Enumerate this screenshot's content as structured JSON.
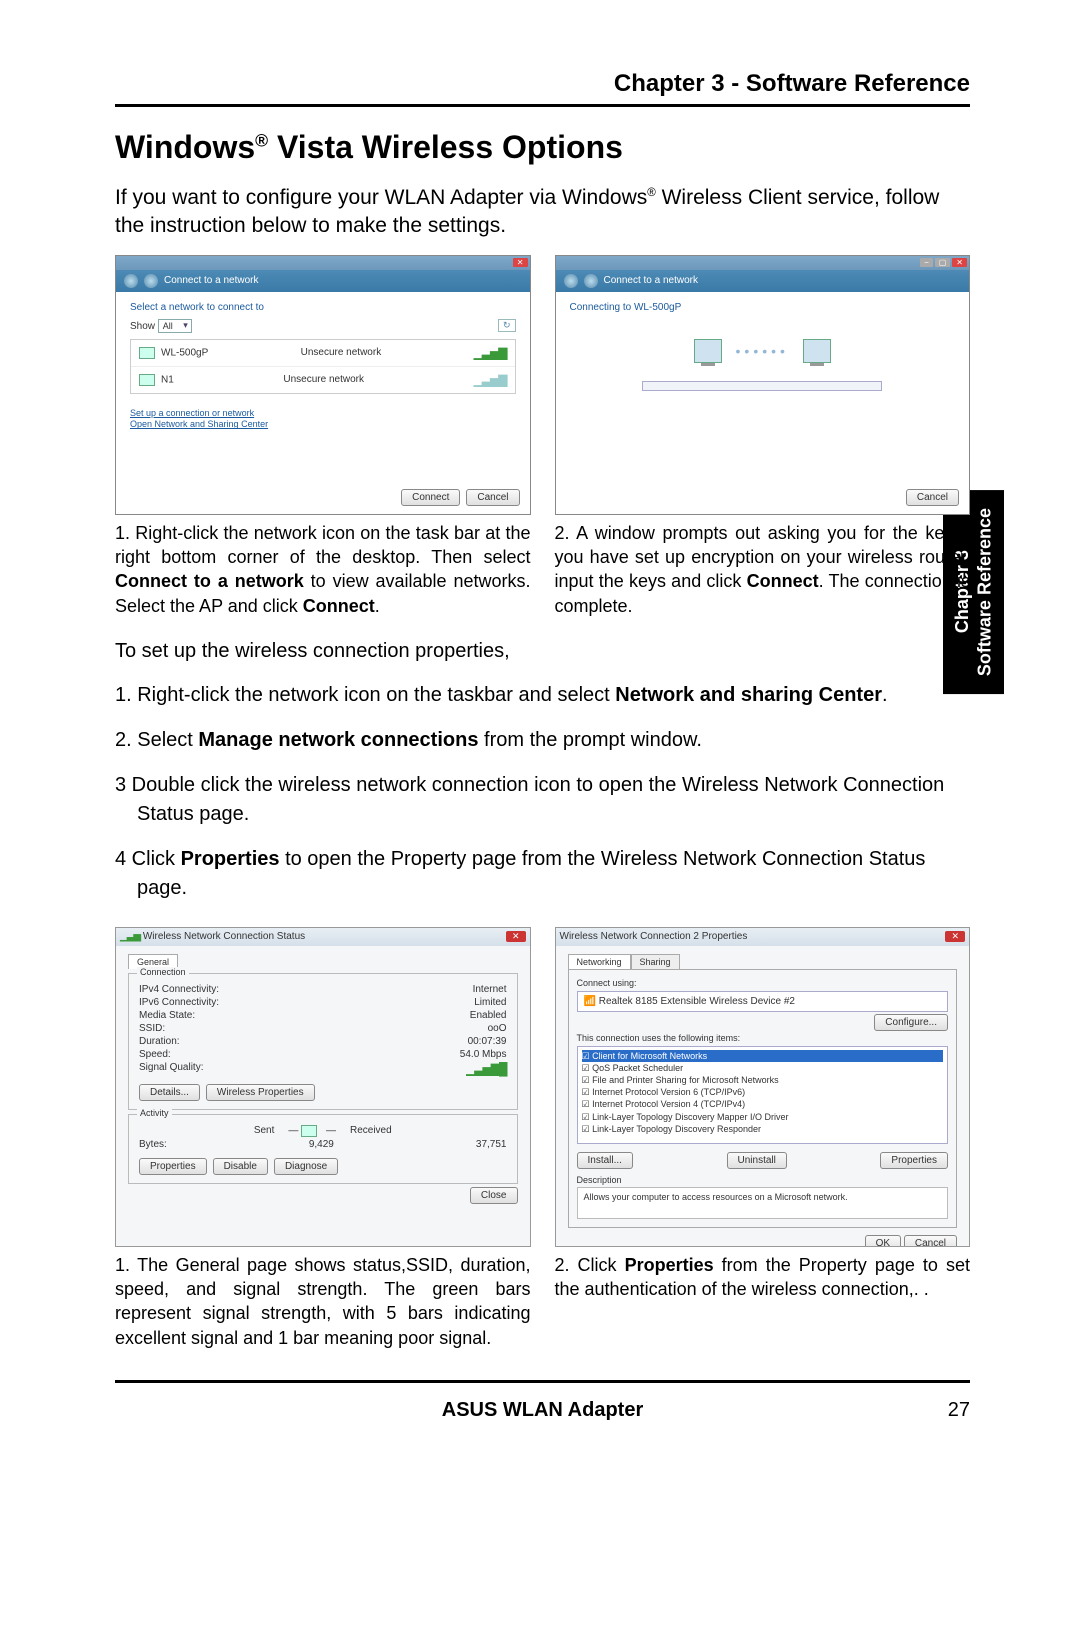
{
  "header": {
    "chapter_title": "Chapter 3 - Software Reference"
  },
  "title": {
    "prefix": "Windows",
    "reg": "®",
    "rest": " Vista Wireless Options"
  },
  "intro": {
    "t1": "If you want to configure your WLAN Adapter via Windows",
    "reg": "®",
    "t2": " Wireless Client service, follow the instruction below to make the settings."
  },
  "win1": {
    "breadcrumb": "Connect to a network",
    "heading": "Select a network to connect to",
    "show_lbl": "Show",
    "show_val": "All",
    "refresh": "↻",
    "net1_name": "WL-500gP",
    "net1_type": "Unsecure network",
    "net2_name": "N1",
    "net2_type": "Unsecure network",
    "link1": "Set up a connection or network",
    "link2": "Open Network and Sharing Center",
    "btn_connect": "Connect",
    "btn_cancel": "Cancel"
  },
  "win2": {
    "breadcrumb": "Connect to a network",
    "status": "Connecting to WL-500gP",
    "btn_cancel": "Cancel"
  },
  "step1": "1. Right-click the network icon on the task bar at the right bottom corner of the desktop. Then select ",
  "step1b": "Connect to a network",
  "step1c": " to view available networks. Select the AP and click ",
  "step1d": "Connect",
  "step1e": ".",
  "step2": "2. A window prompts out asking you for the key if you have set up encryption on your wireless router, input the keys and click ",
  "step2b": "Connect",
  "step2c": ". The connection is complete.",
  "props_intro": "To set up the wireless connection properties,",
  "prop_steps": {
    "s1a": "1. Right-click the network icon on the taskbar and select ",
    "s1b": "Network and sharing Center",
    "s1c": ".",
    "s2a": "2. Select ",
    "s2b": "Manage network connections",
    "s2c": " from the prompt window.",
    "s3": "3  Double click the wireless network connection icon to open the Wireless Network Connection Status page.",
    "s4a": "4 Click ",
    "s4b": "Properties",
    "s4c": " to open the Property page from the Wireless Network Connection Status page."
  },
  "dlgA": {
    "title": "Wireless Network Connection Status",
    "tab": "General",
    "fs1": "Connection",
    "ipv4_l": "IPv4 Connectivity:",
    "ipv4_v": "Internet",
    "ipv6_l": "IPv6 Connectivity:",
    "ipv6_v": "Limited",
    "media_l": "Media State:",
    "media_v": "Enabled",
    "ssid_l": "SSID:",
    "ssid_v": "ooO",
    "dur_l": "Duration:",
    "dur_v": "00:07:39",
    "spd_l": "Speed:",
    "spd_v": "54.0 Mbps",
    "sq_l": "Signal Quality:",
    "btn_details": "Details...",
    "btn_wp": "Wireless Properties",
    "fs2": "Activity",
    "sent": "Sent",
    "recv": "Received",
    "bytes_l": "Bytes:",
    "bytes_s": "9,429",
    "bytes_r": "37,751",
    "btn_props": "Properties",
    "btn_disable": "Disable",
    "btn_diag": "Diagnose",
    "btn_close": "Close"
  },
  "dlgB": {
    "title": "Wireless Network Connection 2 Properties",
    "tab1": "Networking",
    "tab2": "Sharing",
    "cu_lbl": "Connect using:",
    "device": "Realtek 8185 Extensible Wireless Device #2",
    "btn_cfg": "Configure...",
    "items_lbl": "This connection uses the following items:",
    "i1": "Client for Microsoft Networks",
    "i2": "QoS Packet Scheduler",
    "i3": "File and Printer Sharing for Microsoft Networks",
    "i4": "Internet Protocol Version 6 (TCP/IPv6)",
    "i5": "Internet Protocol Version 4 (TCP/IPv4)",
    "i6": "Link-Layer Topology Discovery Mapper I/O Driver",
    "i7": "Link-Layer Topology Discovery Responder",
    "btn_inst": "Install...",
    "btn_unin": "Uninstall",
    "btn_prop": "Properties",
    "desc_l": "Description",
    "desc": "Allows your computer to access resources on a Microsoft network.",
    "btn_ok": "OK",
    "btn_cancel": "Cancel"
  },
  "cap1": "1. The General page shows status,SSID, duration, speed, and signal strength. The green bars represent signal strength, with 5 bars indicating excellent signal and 1 bar meaning poor signal.",
  "cap2a": "2. Click ",
  "cap2b": "Properties",
  "cap2c": " from the Property page to set the authentication of the wireless connection,.   .",
  "footer": {
    "brand": "ASUS WLAN Adapter",
    "page": "27"
  },
  "sidetab": {
    "l1": "Chapter 3",
    "l2": "Software Reference"
  }
}
